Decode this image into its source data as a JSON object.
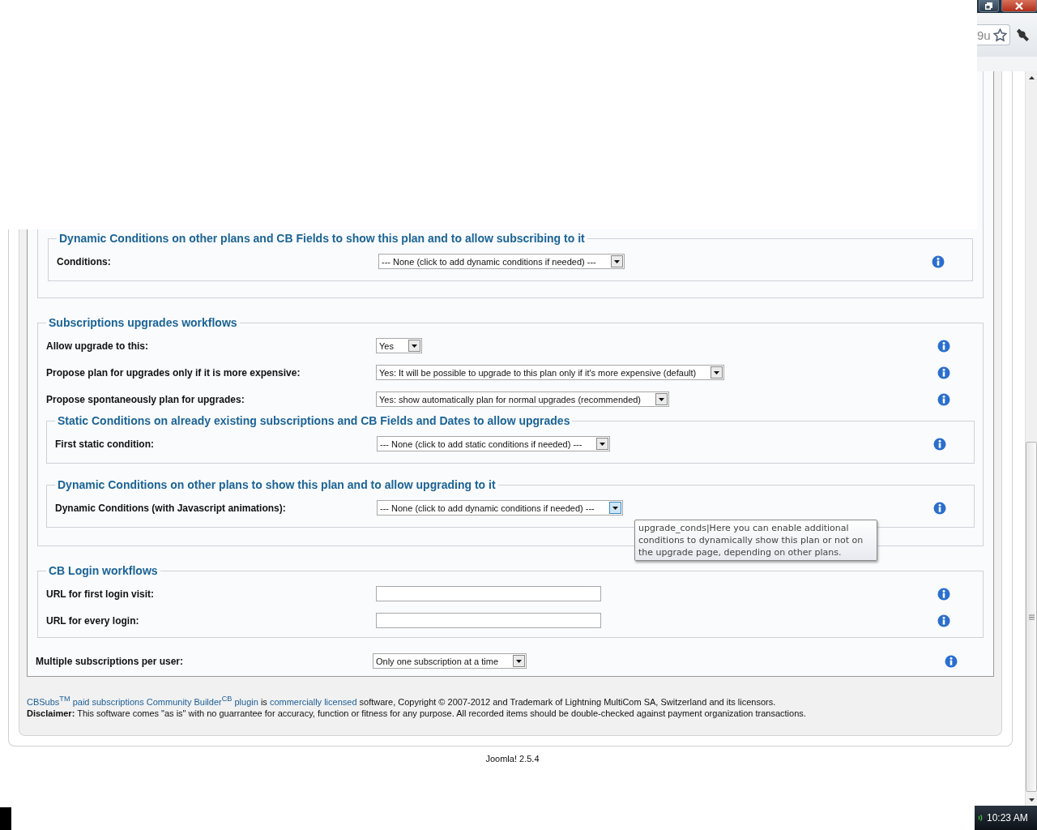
{
  "browser": {
    "url_text": "9u"
  },
  "groups": [
    {
      "items": [
        {
          "kind": "fieldset",
          "legend": "Dynamic Conditions on other plans and CB Fields to show this plan and to allow subscribing to it",
          "rows": [
            {
              "kind": "select",
              "label": "Conditions:",
              "value": "--- None (click to add dynamic conditions if needed) ---",
              "focused": false
            }
          ]
        }
      ]
    },
    {
      "legend": "Subscriptions upgrades workflows",
      "items": [
        {
          "kind": "select",
          "label": "Allow upgrade to this:",
          "value": "Yes",
          "focused": false
        },
        {
          "kind": "select",
          "label": "Propose plan for upgrades only if it is more expensive:",
          "value": "Yes: It will be possible to upgrade to this plan only if it's more expensive (default)",
          "focused": false
        },
        {
          "kind": "select",
          "label": "Propose spontaneously plan for upgrades:",
          "value": "Yes: show automatically plan for normal upgrades (recommended)",
          "focused": false
        },
        {
          "kind": "fieldset",
          "legend": "Static Conditions on already existing subscriptions and CB Fields and Dates to allow upgrades",
          "rows": [
            {
              "kind": "select",
              "label": "First static condition:",
              "value": "--- None (click to add static conditions if needed) ---",
              "focused": false
            }
          ]
        },
        {
          "kind": "fieldset",
          "legend": "Dynamic Conditions on other plans to show this plan and to allow upgrading to it",
          "rows": [
            {
              "kind": "select",
              "label": "Dynamic Conditions (with Javascript animations):",
              "value": "--- None (click to add dynamic conditions if needed) ---",
              "focused": true,
              "tooltip": "upgrade_conds|Here you can enable additional conditions to dynamically show this plan or not on the upgrade page, depending on other plans."
            }
          ]
        }
      ]
    },
    {
      "legend": "CB Login workflows",
      "items": [
        {
          "kind": "text",
          "label": "URL for first login visit:"
        },
        {
          "kind": "text",
          "label": "URL for every login:"
        }
      ]
    }
  ],
  "standalone": {
    "kind": "select",
    "label": "Multiple subscriptions per user:",
    "value": "Only one subscription at a time",
    "focused": false
  },
  "footer": {
    "parts": [
      {
        "text": "CBSubs$^{TM}$ paid subscriptions Community Builder$^{CB}$ plugin",
        "link": true
      },
      {
        "text": " is ",
        "link": false
      },
      {
        "text": "commercially licensed",
        "link": true
      },
      {
        "text": " software, Copyright © 2007-2012 and Trademark of Lightning MultiCom SA, Switzerland and its licensors.",
        "link": false
      }
    ],
    "disclaimer": "**Disclaimer:** This software comes \"as is\" with no guarrantee for accuracy, function or fitness for any purpose. All recorded items should be double-checked against payment organization transactions."
  },
  "version": "Joomla! 2.5.4",
  "taskbar": {
    "time": "10:23 AM"
  }
}
